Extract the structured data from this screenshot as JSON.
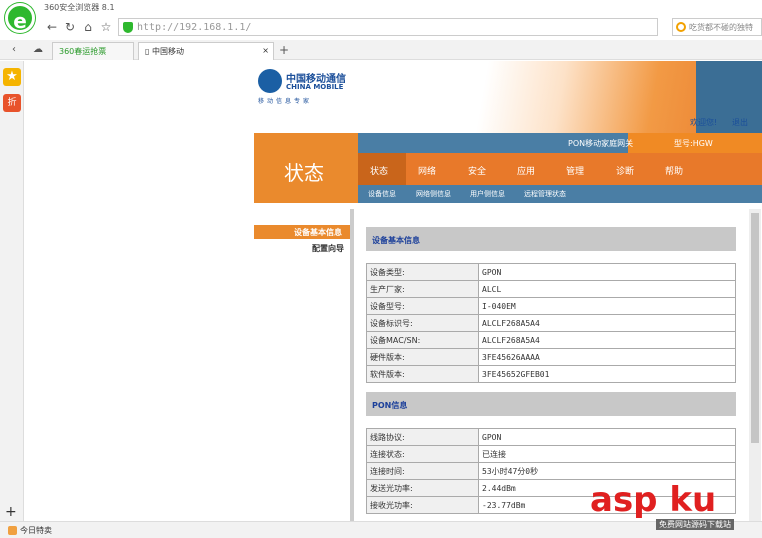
{
  "browser": {
    "title": "360安全浏览器 8.1",
    "url": "http://192.168.1.1/",
    "search_placeholder": "吃货都不碰的独特",
    "tabs": [
      {
        "label": "360春运抢票"
      },
      {
        "label": "中国移动"
      }
    ],
    "status_text": "今日特卖"
  },
  "router": {
    "brand": {
      "name": "中国移动通信",
      "english": "CHINA MOBILE",
      "slogan": "移动信息专家"
    },
    "welcome": "欢迎您!",
    "logout": "退出",
    "gateway_label": "PON移动家庭网关",
    "model": "型号:HGW",
    "section_title": "状态",
    "menu": [
      "状态",
      "网络",
      "安全",
      "应用",
      "管理",
      "诊断",
      "帮助"
    ],
    "submenu": [
      "设备信息",
      "网络侧信息",
      "用户侧信息",
      "远程管理状态"
    ],
    "left_nav": [
      "设备基本信息",
      "配置向导"
    ],
    "device_section": {
      "title": "设备基本信息",
      "rows": [
        {
          "k": "设备类型:",
          "v": "GPON"
        },
        {
          "k": "生产厂家:",
          "v": "ALCL"
        },
        {
          "k": "设备型号:",
          "v": "I-040EM"
        },
        {
          "k": "设备标识号:",
          "v": "ALCLF268A5A4"
        },
        {
          "k": "设备MAC/SN:",
          "v": "ALCLF268A5A4"
        },
        {
          "k": "硬件版本:",
          "v": "3FE45626AAAA"
        },
        {
          "k": "软件版本:",
          "v": "3FE45652GFEB01"
        }
      ]
    },
    "pon_section": {
      "title": "PON信息",
      "rows": [
        {
          "k": "线路协议:",
          "v": "GPON"
        },
        {
          "k": "连接状态:",
          "v": "已连接"
        },
        {
          "k": "连接时间:",
          "v": "53小时47分0秒"
        },
        {
          "k": "发送光功率:",
          "v": "2.44dBm"
        },
        {
          "k": "接收光功率:",
          "v": "-23.77dBm"
        }
      ]
    }
  },
  "watermark": {
    "text": "asp ku",
    "sub": "免费网站源码下载站"
  }
}
